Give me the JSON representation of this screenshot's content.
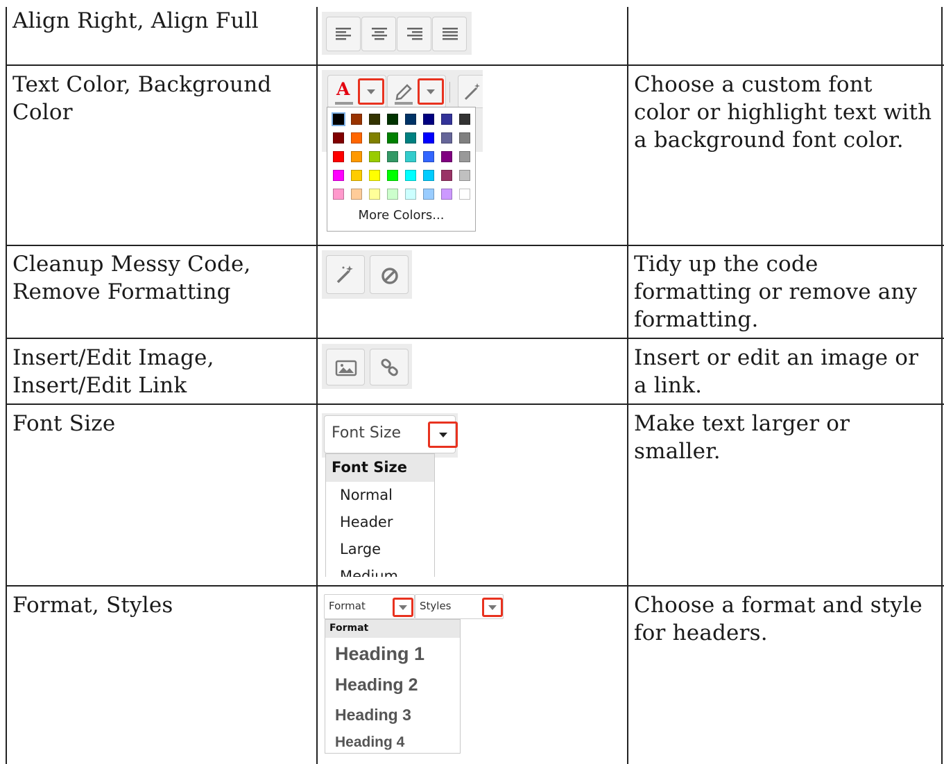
{
  "rows": [
    {
      "feature": [
        "Align Right, Align Full"
      ],
      "description": []
    },
    {
      "feature": [
        "Text Color, Background",
        "Color"
      ],
      "description": [
        "Choose a custom font",
        "color or highlight text with",
        "a background font color."
      ]
    },
    {
      "feature": [
        "Cleanup Messy Code,",
        "Remove Formatting"
      ],
      "description": [
        "Tidy up the code",
        "formatting or remove any",
        "formatting."
      ]
    },
    {
      "feature": [
        "Insert/Edit Image,",
        "Insert/Edit Link"
      ],
      "description": [
        "Insert or edit an image or",
        "a link."
      ]
    },
    {
      "feature": [
        "Font Size"
      ],
      "description": [
        "Make text larger or",
        "smaller."
      ]
    },
    {
      "feature": [
        "Format, Styles"
      ],
      "description": [
        "Choose a format and style",
        "for headers."
      ]
    }
  ],
  "color_picker": {
    "more_colors_label": "More Colors...",
    "text_color_glyph": "A",
    "swatches": [
      [
        "#000000",
        "#993300",
        "#333300",
        "#003300",
        "#003366",
        "#000080",
        "#333399",
        "#333333"
      ],
      [
        "#800000",
        "#ff6600",
        "#808000",
        "#008000",
        "#008080",
        "#0000ff",
        "#666699",
        "#808080"
      ],
      [
        "#ff0000",
        "#ff9900",
        "#99cc00",
        "#339966",
        "#33cccc",
        "#3366ff",
        "#800080",
        "#999999"
      ],
      [
        "#ff00ff",
        "#ffcc00",
        "#ffff00",
        "#00ff00",
        "#00ffff",
        "#00ccff",
        "#993366",
        "#c0c0c0"
      ],
      [
        "#ff99cc",
        "#ffcc99",
        "#ffff99",
        "#ccffcc",
        "#ccffff",
        "#99ccff",
        "#cc99ff",
        "#ffffff"
      ]
    ]
  },
  "font_size": {
    "button_label": "Font Size",
    "menu_header": "Font Size",
    "options": [
      "Normal",
      "Header",
      "Large",
      "Medium"
    ]
  },
  "format_styles": {
    "format_label": "Format",
    "styles_label": "Styles",
    "menu_header": "Format",
    "options": [
      "Heading 1",
      "Heading 2",
      "Heading 3",
      "Heading 4"
    ]
  },
  "colors": {
    "highlight": "#e8321f",
    "text_color_red": "#e3000f"
  }
}
